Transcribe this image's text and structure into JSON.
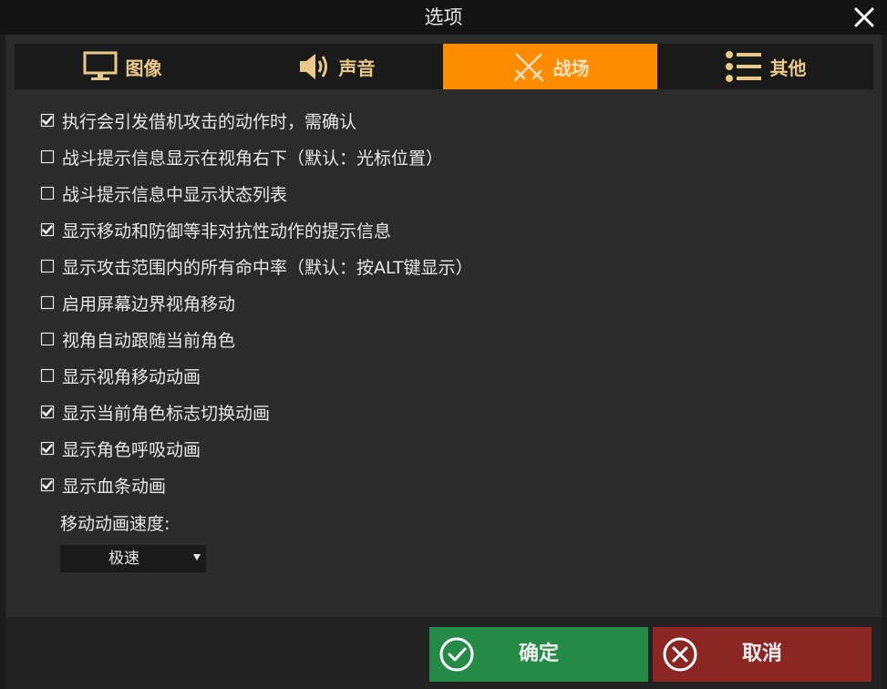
{
  "window": {
    "title": "选项"
  },
  "tabs": [
    {
      "label": "图像",
      "icon": "monitor-icon",
      "active": false
    },
    {
      "label": "声音",
      "icon": "speaker-icon",
      "active": false
    },
    {
      "label": "战场",
      "icon": "crossed-swords-icon",
      "active": true
    },
    {
      "label": "其他",
      "icon": "list-icon",
      "active": false
    }
  ],
  "options": [
    {
      "label": "执行会引发借机攻击的动作时，需确认",
      "checked": true
    },
    {
      "label": "战斗提示信息显示在视角右下（默认：光标位置）",
      "checked": false
    },
    {
      "label": "战斗提示信息中显示状态列表",
      "checked": false
    },
    {
      "label": "显示移动和防御等非对抗性动作的提示信息",
      "checked": true
    },
    {
      "label": "显示攻击范围内的所有命中率（默认：按ALT键显示）",
      "checked": false
    },
    {
      "label": "启用屏幕边界视角移动",
      "checked": false
    },
    {
      "label": "视角自动跟随当前角色",
      "checked": false
    },
    {
      "label": "显示视角移动动画",
      "checked": false
    },
    {
      "label": "显示当前角色标志切换动画",
      "checked": true
    },
    {
      "label": "显示角色呼吸动画",
      "checked": true
    },
    {
      "label": "显示血条动画",
      "checked": true
    }
  ],
  "speed": {
    "label": "移动动画速度:",
    "value": "极速"
  },
  "buttons": {
    "ok": "确定",
    "cancel": "取消"
  },
  "colors": {
    "accent": "#ff8c00",
    "ok": "#238b46",
    "cancel": "#8b2623",
    "tab_text": "#e8c98a"
  }
}
